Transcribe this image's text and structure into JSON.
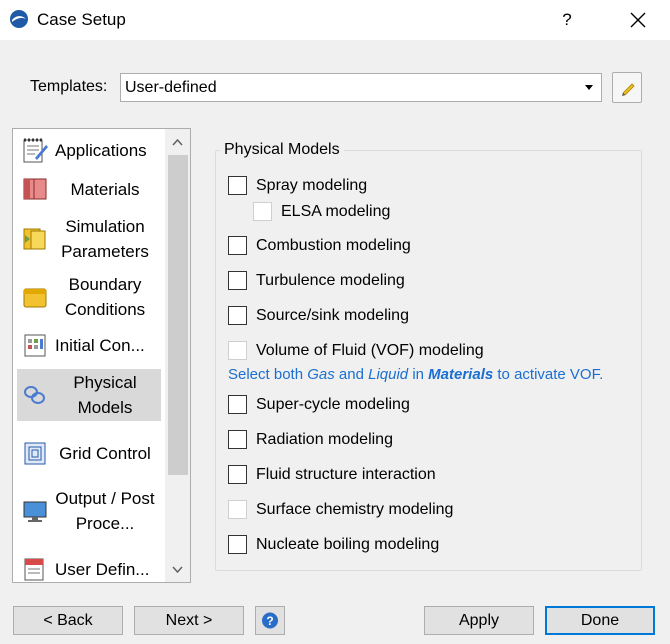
{
  "window": {
    "title": "Case Setup",
    "help": "?"
  },
  "templates": {
    "label": "Templates:",
    "value": "User-defined"
  },
  "nav": {
    "items": [
      {
        "label": "Applications"
      },
      {
        "label": "Materials"
      },
      {
        "label": "Simulation Parameters"
      },
      {
        "label": "Boundary Conditions"
      },
      {
        "label": "Initial Con..."
      },
      {
        "label": "Physical Models",
        "selected": true
      },
      {
        "label": "Grid Control"
      },
      {
        "label": "Output / Post Proce..."
      },
      {
        "label": "User Defin..."
      }
    ]
  },
  "physical_models": {
    "title": "Physical Models",
    "options": [
      {
        "label": "Spray modeling",
        "checked": false,
        "enabled": true
      },
      {
        "label": "ELSA modeling",
        "checked": false,
        "enabled": false
      },
      {
        "label": "Combustion modeling",
        "checked": false,
        "enabled": true
      },
      {
        "label": "Turbulence modeling",
        "checked": false,
        "enabled": true
      },
      {
        "label": "Source/sink modeling",
        "checked": false,
        "enabled": true
      },
      {
        "label": "Volume of Fluid (VOF) modeling",
        "checked": false,
        "enabled": false
      },
      {
        "label": "Super-cycle modeling",
        "checked": false,
        "enabled": true
      },
      {
        "label": "Radiation modeling",
        "checked": false,
        "enabled": true
      },
      {
        "label": "Fluid structure interaction",
        "checked": false,
        "enabled": true
      },
      {
        "label": "Surface chemistry modeling",
        "checked": false,
        "enabled": false
      },
      {
        "label": "Nucleate boiling modeling",
        "checked": false,
        "enabled": true
      }
    ],
    "vof_note": {
      "part1": "Select both ",
      "gas": "Gas",
      "and": " and ",
      "liquid": "Liquid",
      "in": " in ",
      "materials": "Materials",
      "part2": " to activate VOF."
    }
  },
  "buttons": {
    "back": "< Back",
    "next": "Next >",
    "apply": "Apply",
    "done": "Done"
  },
  "colors": {
    "accent": "#0078d7",
    "note": "#1a6fd1"
  }
}
